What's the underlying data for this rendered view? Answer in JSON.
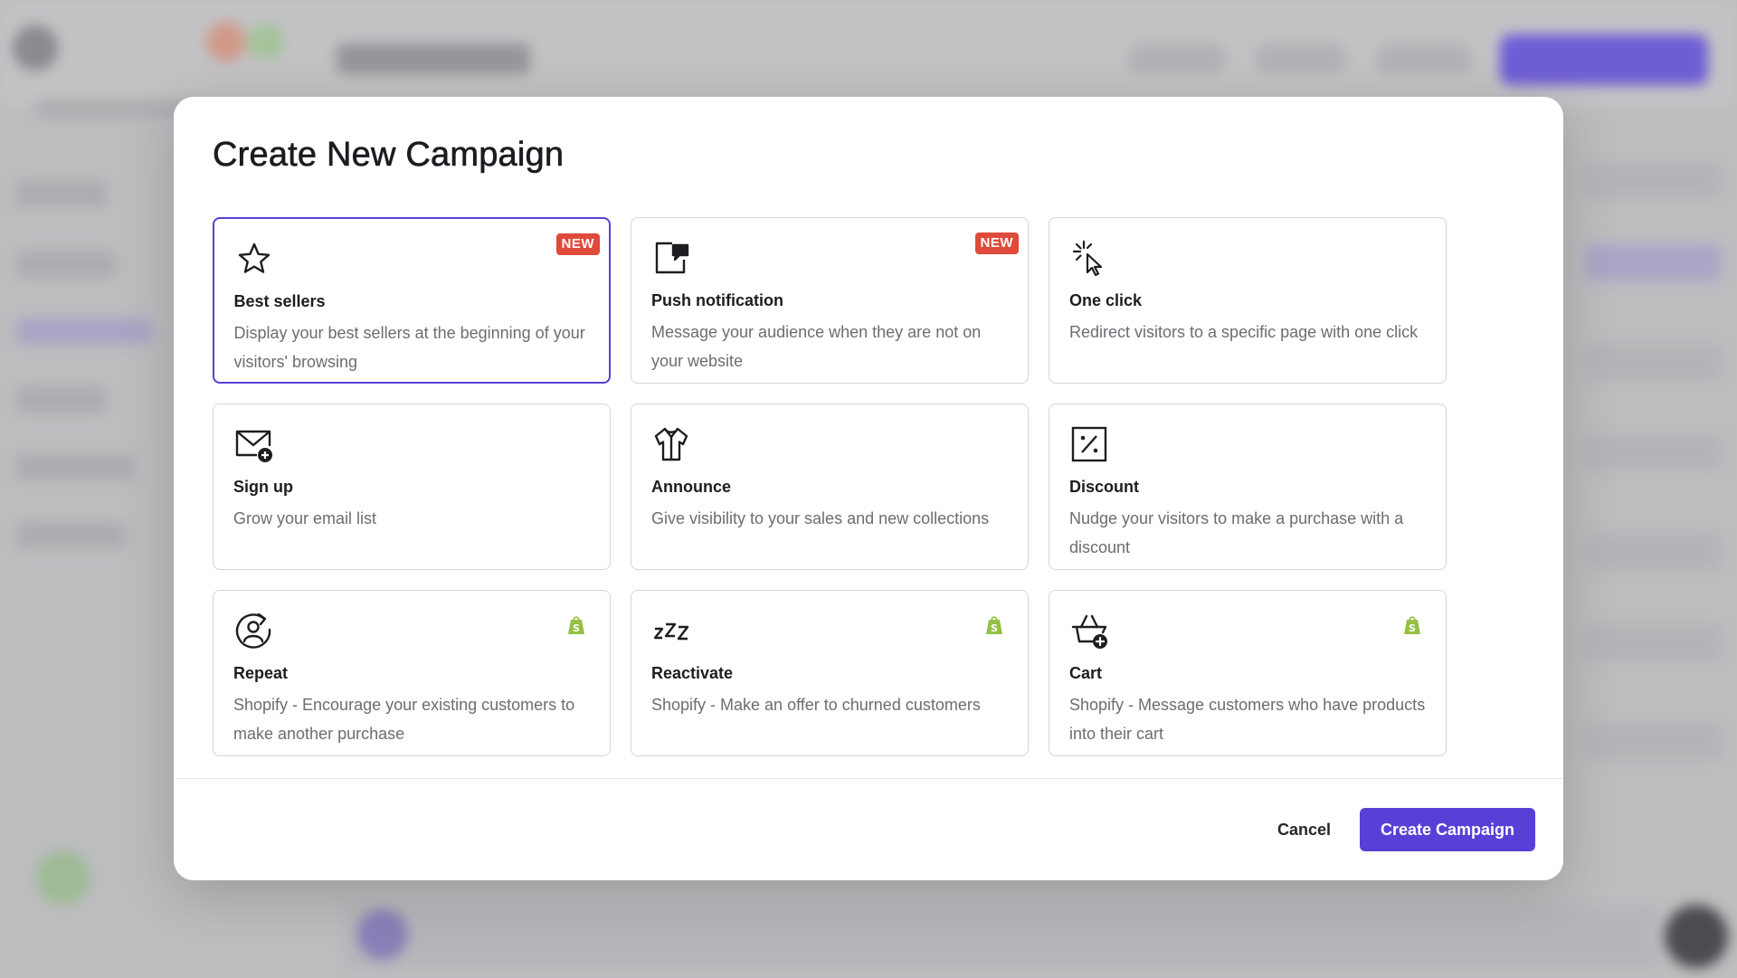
{
  "modal": {
    "title": "Create New Campaign",
    "badge_new": "NEW",
    "cards": [
      {
        "title": "Best sellers",
        "desc": "Display your best sellers at the beginning of your visitors' browsing",
        "icon": "star-icon",
        "badge": "NEW",
        "selected": true
      },
      {
        "title": "Push notification",
        "desc": "Message your audience when they are not on your website",
        "icon": "push-notification-icon",
        "badge": "NEW"
      },
      {
        "title": "One click",
        "desc": "Redirect visitors to a specific page with one click",
        "icon": "cursor-click-icon"
      },
      {
        "title": "Sign up",
        "desc": "Grow your email list",
        "icon": "mail-plus-icon"
      },
      {
        "title": "Announce",
        "desc": "Give visibility to your sales and new collections",
        "icon": "tshirt-icon"
      },
      {
        "title": "Discount",
        "desc": "Nudge your visitors to make a purchase with a discount",
        "icon": "percent-icon"
      },
      {
        "title": "Repeat",
        "desc": "Shopify - Encourage your existing customers to make another purchase",
        "icon": "repeat-user-icon",
        "shopify": true
      },
      {
        "title": "Reactivate",
        "desc": "Shopify - Make an offer to churned customers",
        "icon": "zzz-icon",
        "shopify": true
      },
      {
        "title": "Cart",
        "desc": "Shopify - Message customers who have products into their cart",
        "icon": "basket-plus-icon",
        "shopify": true
      }
    ],
    "cancel_label": "Cancel",
    "create_label": "Create Campaign"
  },
  "colors": {
    "accent": "#5a3fd6",
    "badge": "#e04a3a",
    "shopify": "#95bf47"
  }
}
